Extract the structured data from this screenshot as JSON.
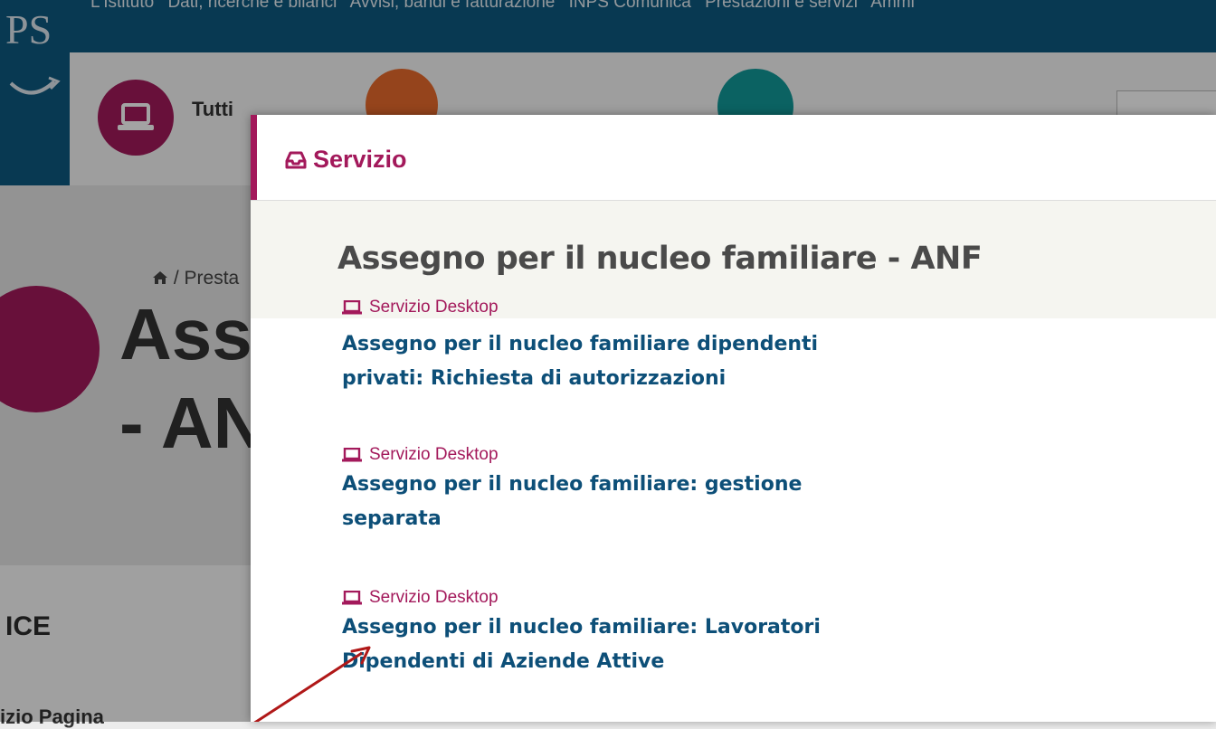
{
  "top_nav": {
    "items": [
      "L'Istituto",
      "Dati, ricerche e bilanci",
      "Avvisi, bandi e fatturazione",
      "INPS Comunica",
      "Prestazioni e servizi",
      "Ammi"
    ]
  },
  "logo": {
    "text": "PS"
  },
  "subbar": {
    "tutti_label": "Tutti"
  },
  "page": {
    "breadcrumb": "/ Presta",
    "title_line1": "Ass",
    "title_line2": "- AN",
    "side_heading": "ICE",
    "side_item": "izio Pagina"
  },
  "modal": {
    "header_label": "Servizio",
    "title": "Assegno per il nucleo familiare - ANF",
    "entries": [
      {
        "tag": "Servizio Desktop",
        "line1": "Assegno per il nucleo familiare dipendenti",
        "line2": "privati: Richiesta di autorizzazioni"
      },
      {
        "tag": "Servizio Desktop",
        "line1": "Assegno per il nucleo familiare: gestione",
        "line2": "separata"
      },
      {
        "tag": "Servizio Desktop",
        "line1": "Assegno per il nucleo familiare: Lavoratori",
        "line2": "Dipendenti di Aziende Attive"
      }
    ]
  },
  "colors": {
    "brand": "#a3195b",
    "link": "#0d4f78",
    "nav": "#0d5a80",
    "arrow": "#b01818"
  },
  "icons": {
    "header": "inbox-tray-icon",
    "entry": "laptop-icon",
    "breadcrumb": "home-icon"
  }
}
